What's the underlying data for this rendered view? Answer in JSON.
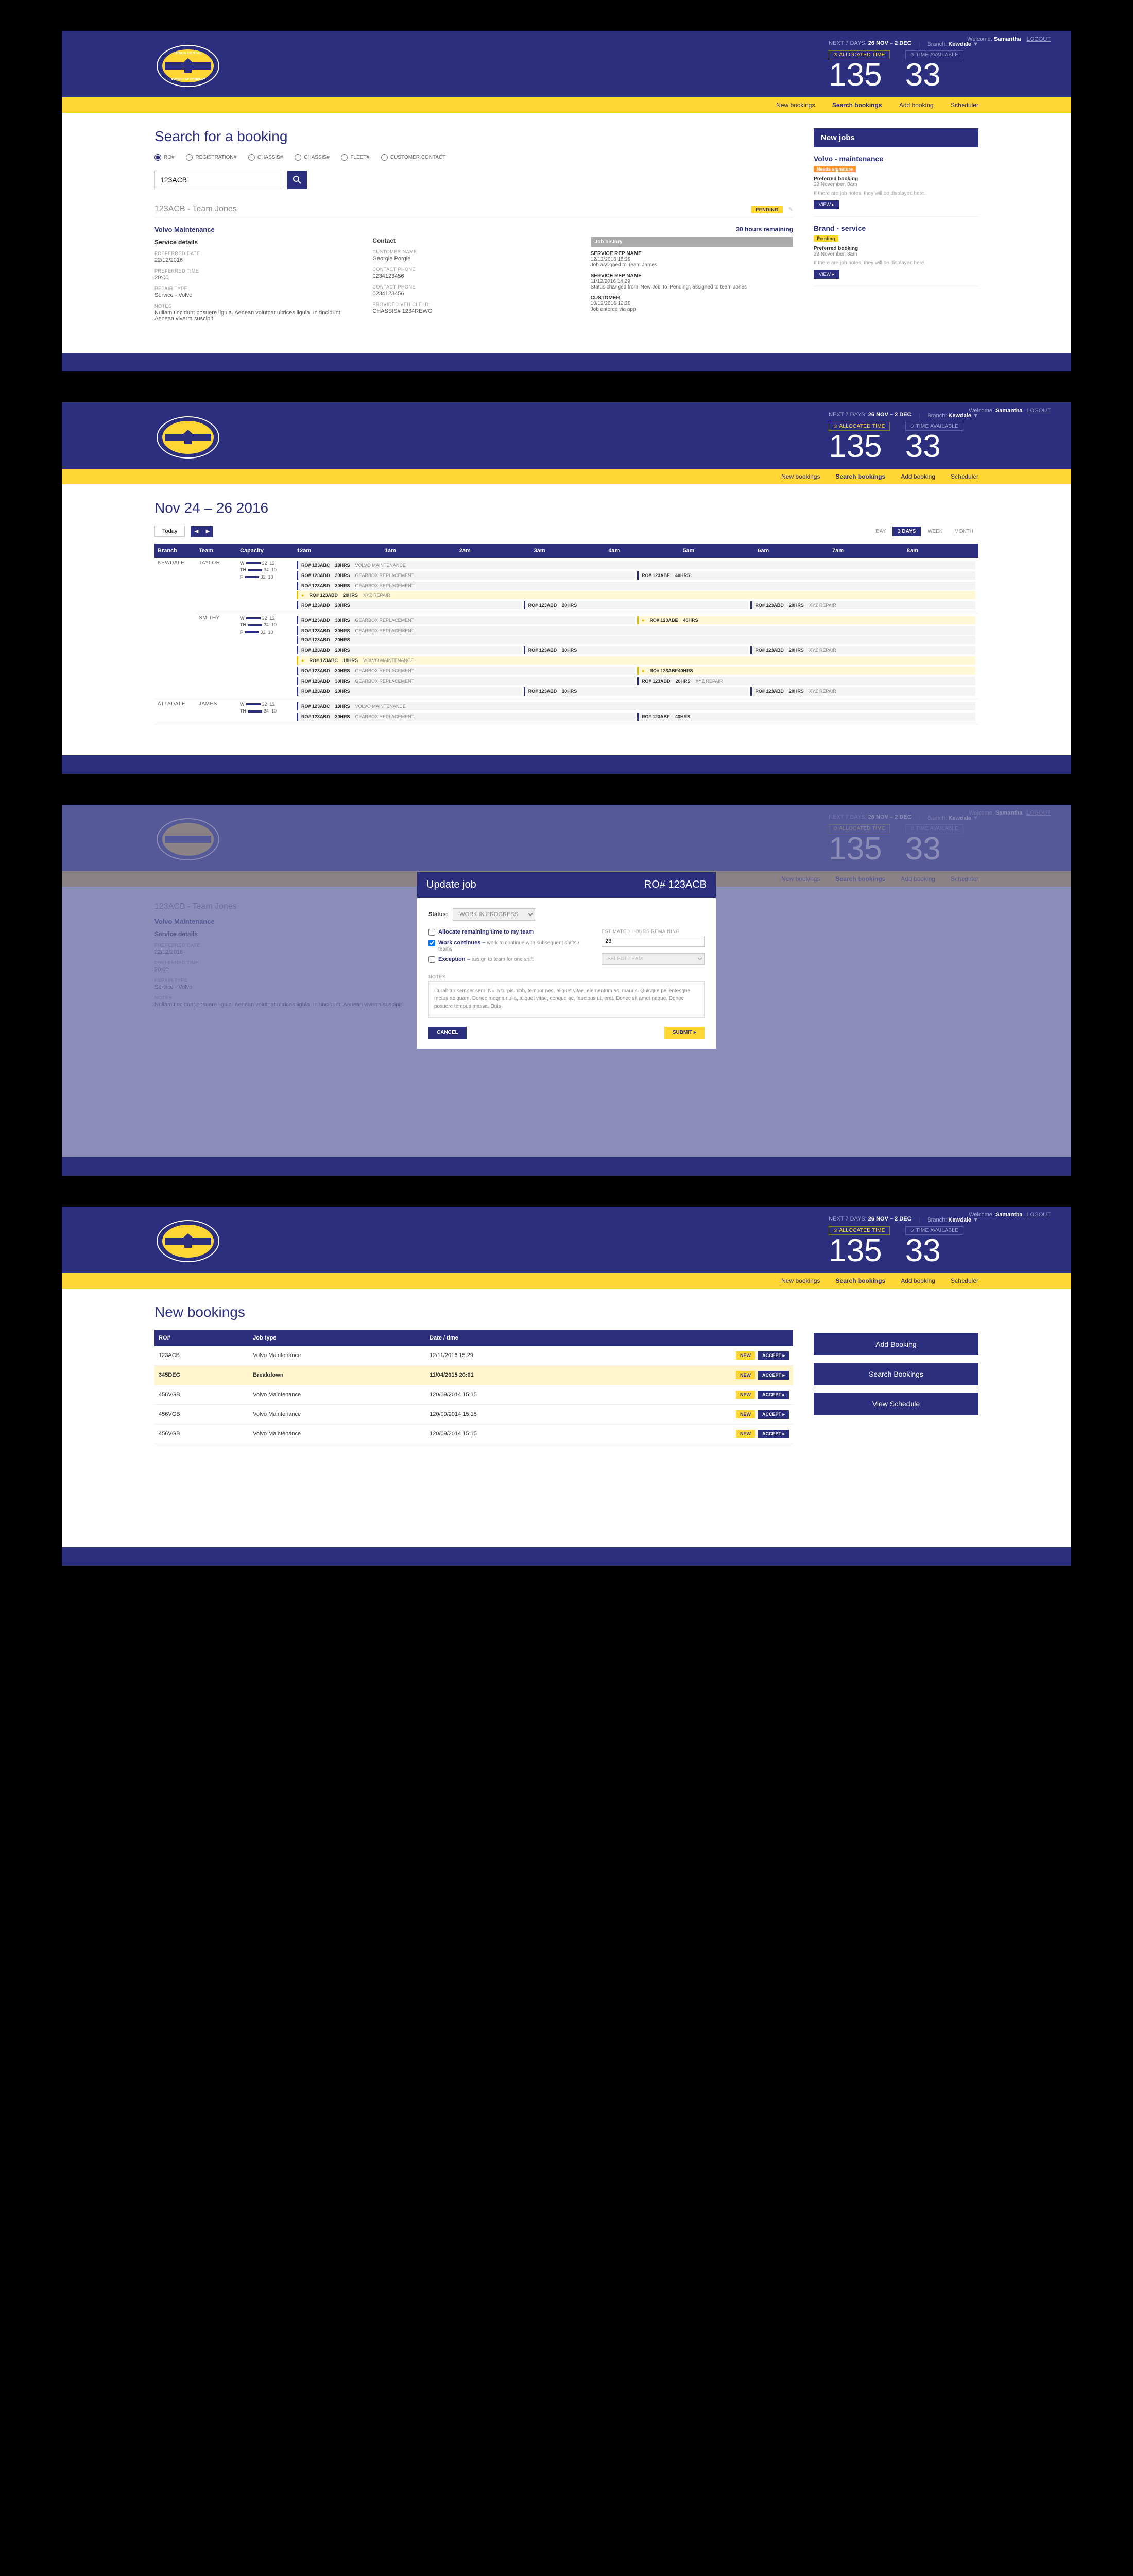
{
  "welcome": {
    "prefix": "Welcome,",
    "user": "Samantha",
    "logout": "LOGOUT"
  },
  "header": {
    "next7_label": "NEXT 7 DAYS:",
    "next7_range": "26 NOV – 2 DEC",
    "branch_label": "Branch:",
    "branch_value": "Kewdale",
    "allocated_label": "⊙ ALLOCATED TIME",
    "available_label": "⊙ TIME AVAILABLE",
    "allocated": "135",
    "available": "33"
  },
  "nav": {
    "new": "New bookings",
    "search": "Search bookings",
    "add": "Add booking",
    "sched": "Scheduler"
  },
  "screen1": {
    "title": "Search for a booking",
    "radios": [
      "RO#",
      "REGISTRATION#",
      "CHASSIS#",
      "CHASSIS#",
      "FLEET#",
      "CUSTOMER CONTACT"
    ],
    "search_value": "123ACB",
    "booking_title": "123ACB - Team Jones",
    "pending": "PENDING",
    "volvo": "Volvo Maintenance",
    "hours_rem": "30 hours remaining",
    "service_details": "Service details",
    "pref_date_l": "PREFERRED DATE",
    "pref_date": "22/12/2016",
    "pref_time_l": "PREFERRED TIME",
    "pref_time": "20:00",
    "repair_l": "REPAIR TYPE",
    "repair": "Service - Volvo",
    "notes_l": "NOTES",
    "notes": "Nullam tincidunt posuere ligula. Aenean volutpat ultrices ligula. In tincidunt. Aenean viverra suscipit",
    "contact": "Contact",
    "cname_l": "CUSTOMER NAME",
    "cname": "Georgie Porgie",
    "cphone_l": "CONTACT PHONE",
    "cphone": "0234123456",
    "cphone2_l": "CONTACT PHONE",
    "cphone2": "0234123456",
    "veh_l": "PROVIDED VEHICLE ID:",
    "veh": "CHASSIS# 1234REWG",
    "jobhist": "Job history",
    "hist": [
      {
        "t": "SERVICE REP NAME",
        "d": "12/12/2016 15:29",
        "txt": "Job assigned to Team James"
      },
      {
        "t": "SERVICE REP NAME",
        "d": "11/12/2016 14:29",
        "txt": "Status changed from 'New Job' to 'Pending', assigned to team Jones"
      },
      {
        "t": "CUSTOMER",
        "d": "10/12/2016 12:20",
        "txt": "Job entered via app"
      }
    ],
    "side_title": "New jobs",
    "side_jobs": [
      {
        "title": "Volvo - maintenance",
        "tag": "Needs signature",
        "tagClass": "pending-orange",
        "sub": "Preferred booking",
        "date": "29 November, 8am",
        "note": "If there are job notes, they will be displayed here.",
        "view": "VIEW"
      },
      {
        "title": "Brand - service",
        "tag": "Pending",
        "tagClass": "pending-yellow",
        "sub": "Preferred booking",
        "date": "29 November, 8am",
        "note": "If there are job notes, they will be displayed here.",
        "view": "VIEW"
      }
    ]
  },
  "screen2": {
    "title": "Nov 24 – 26 2016",
    "today": "Today",
    "tabs": {
      "day": "DAY",
      "d3": "3 DAYS",
      "week": "WEEK",
      "month": "MONTH"
    },
    "cols": [
      "Branch",
      "Team",
      "Capacity",
      "12am",
      "1am",
      "2am",
      "3am",
      "4am",
      "5am",
      "6am",
      "7am",
      "8am"
    ],
    "branches": [
      {
        "name": "KEWDALE",
        "teams": [
          {
            "name": "TAYLOR",
            "cap": [
              [
                "W",
                "32",
                "12"
              ],
              [
                "TH",
                "34",
                "10"
              ],
              [
                "F",
                "32",
                "10"
              ]
            ]
          },
          {
            "name": "SMITHY",
            "cap": [
              [
                "W",
                "32",
                "12"
              ],
              [
                "TH",
                "34",
                "10"
              ],
              [
                "F",
                "32",
                "10"
              ]
            ]
          }
        ]
      },
      {
        "name": "ATTADALE",
        "teams": [
          {
            "name": "JAMES",
            "cap": [
              [
                "W",
                "32",
                "12"
              ],
              [
                "TH",
                "34",
                "10"
              ]
            ]
          }
        ]
      }
    ],
    "bar_labels": {
      "ro_pre": "RO#",
      "ro": "123ABC",
      "ro2": "123ABD",
      "ro3": "123ABE",
      "hrs18": "18HRS",
      "hrs20": "20HRS",
      "hrs30": "30HRS",
      "hrs40": "40HRS",
      "volvo": "VOLVO MAINTENANCE",
      "gear": "GEARBOX REPLACEMENT",
      "xyz": "XYZ REPAIR",
      "roe": "RO# 123ABE40HRS"
    }
  },
  "screen3": {
    "modal_title": "Update job",
    "modal_ro": "RO# 123ACB",
    "status_l": "Status:",
    "status_v": "WORK IN PROGRESS",
    "chk1": "Allocate remaining time to my team",
    "chk2": "Work continues –",
    "chk2d": "work to continue with subsequent shifts / teams",
    "chk3": "Exception –",
    "chk3d": "assign to team for one shift",
    "est_l": "ESTIMATED HOURS REMAINING",
    "est_v": "23",
    "sel_team": "SELECT TEAM",
    "notes_l": "NOTES",
    "notes": "Curabitur semper sem. Nulla turpis nibh, tempor nec, aliquet vitae, elementum ac, mauris.\nQuisque pellentesque metus ac quam. Donec magna nulla, aliquet vitae, congue ac, faucibus ut, erat. Donec sit amet neque. Donec posuere tempus massa. Duis",
    "cancel": "CANCEL",
    "submit": "SUBMIT"
  },
  "screen4": {
    "title": "New bookings",
    "thead": [
      "RO#",
      "Job type",
      "Date / time",
      ""
    ],
    "rows": [
      {
        "ro": "123ACB",
        "type": "Volvo Maintenance",
        "dt": "12/11/2016 15:29",
        "hl": false
      },
      {
        "ro": "345DEG",
        "type": "Breakdown",
        "dt": "11/04/2015 20:01",
        "hl": true
      },
      {
        "ro": "456VGB",
        "type": "Volvo Maintenance",
        "dt": "120/09/2014 15:15",
        "hl": false
      },
      {
        "ro": "456VGB",
        "type": "Volvo Maintenance",
        "dt": "120/09/2014 15:15",
        "hl": false
      },
      {
        "ro": "456VGB",
        "type": "Volvo Maintenance",
        "dt": "120/09/2014 15:15",
        "hl": false
      }
    ],
    "new": "NEW",
    "accept": "ACCEPT",
    "actions": [
      "Add Booking",
      "Search Bookings",
      "View Schedule"
    ]
  }
}
